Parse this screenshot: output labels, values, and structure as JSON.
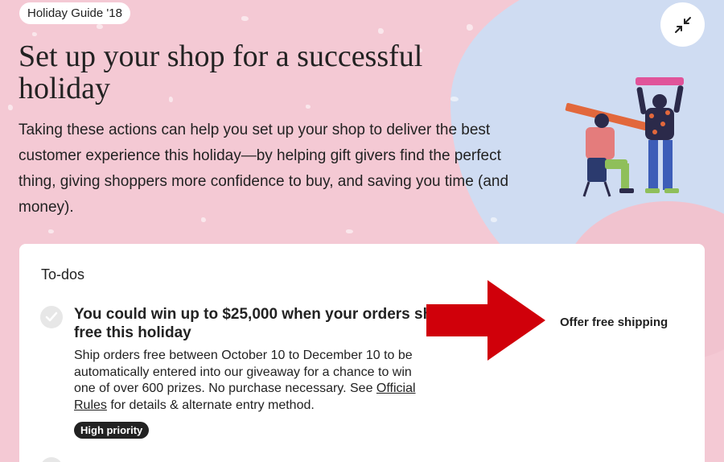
{
  "header": {
    "tag": "Holiday Guide '18",
    "title": "Set up your shop for a successful holiday",
    "intro": "Taking these actions can help you set up your shop to deliver the best customer experience this holiday—by helping gift givers find the perfect thing, giving shoppers more confidence to buy, and saving you time (and money).",
    "collapse_icon": "collapse-arrows-icon"
  },
  "todos": {
    "title": "To-dos",
    "items": [
      {
        "title_line1": "You could win up to $25,000 when your orders ship",
        "title_line2": "free this holiday",
        "desc_pre": "Ship orders free between October 10 to December 10 to be automatically entered into our giveaway for a chance to win one of over 600 prizes. No purchase necessary. See ",
        "desc_link": "Official Rules",
        "desc_post": " for details & alternate entry method.",
        "badge": "High priority",
        "action": "Offer free shipping",
        "completed": false
      }
    ]
  },
  "colors": {
    "background_pink": "#f4c9d4",
    "background_blue": "#cfdcf2",
    "annotation_arrow": "#d0000a",
    "badge_bg": "#222222"
  }
}
